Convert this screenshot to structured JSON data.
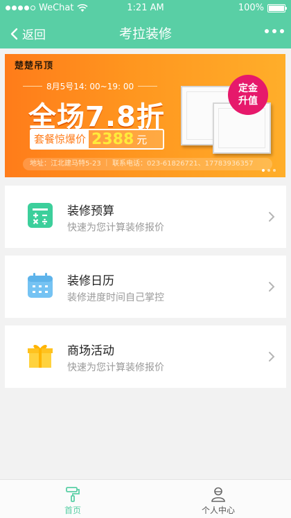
{
  "status_bar": {
    "carrier": "WeChat",
    "time": "1:21 AM",
    "battery": "100%"
  },
  "nav": {
    "back_label": "返回",
    "title": "考拉装修",
    "more_icon": "more-dots-icon"
  },
  "banner": {
    "brand": "楚楚吊顶",
    "datetime": "8月5号14: 00~19: 00",
    "headline": "全场7.8折",
    "price_label": "套餐惊爆价",
    "price_value": "2388",
    "price_unit": "元",
    "badge": "定金升值",
    "info": "地址：江北建马特5-23 ｜ 联系电话：023-61826721、17783936357",
    "slides": 3,
    "active_slide": 1
  },
  "cards": [
    {
      "title": "装修预算",
      "subtitle": "快速为您计算装修报价",
      "icon": "calculator-icon",
      "icon_color": "#3ccf9b"
    },
    {
      "title": "装修日历",
      "subtitle": "装修进度时间自己掌控",
      "icon": "calendar-icon",
      "icon_color": "#75c3f3"
    },
    {
      "title": "商场活动",
      "subtitle": "快速为您计算装修报价",
      "icon": "gift-icon",
      "icon_color": "#ffd23e"
    }
  ],
  "tabbar": {
    "items": [
      {
        "label": "首页",
        "icon": "home-paint-roller-icon",
        "active": true
      },
      {
        "label": "个人中心",
        "icon": "user-icon",
        "active": false
      }
    ]
  },
  "colors": {
    "accent": "#59cfa5",
    "banner_orange": "#ff8a1e",
    "badge_pink": "#e6196b"
  }
}
